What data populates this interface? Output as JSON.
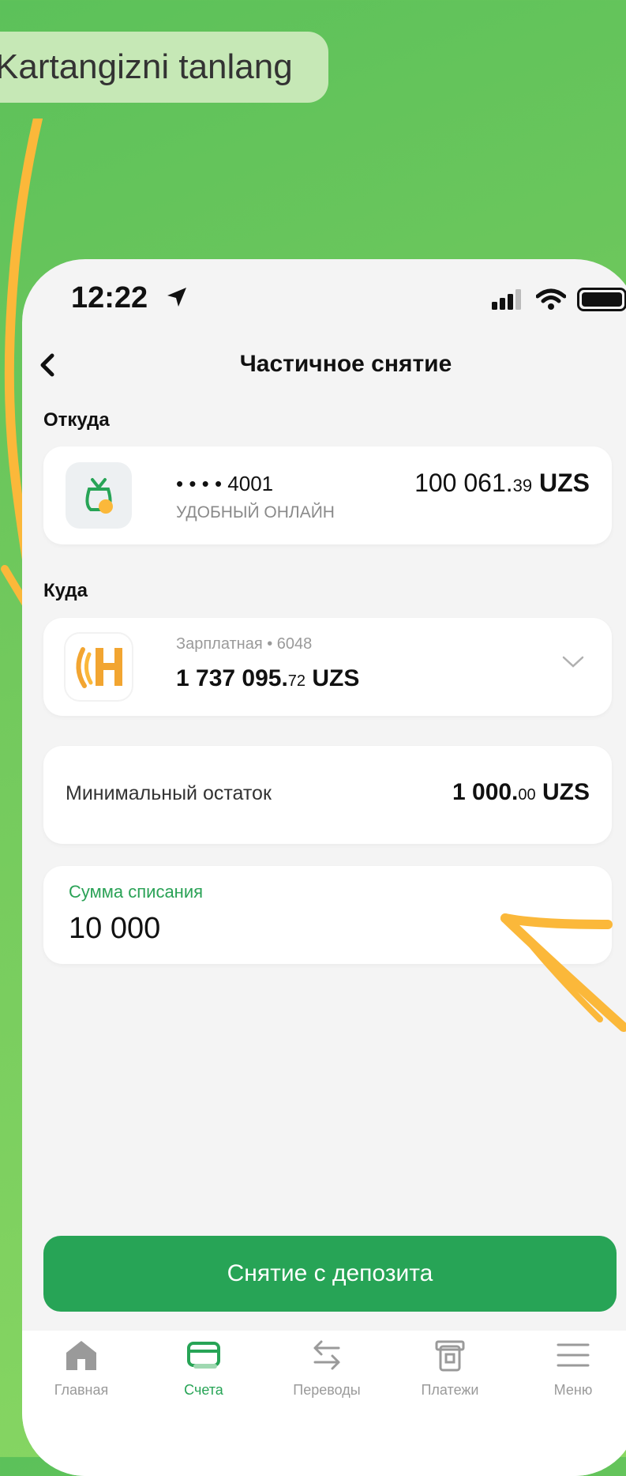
{
  "hint_text": "Kartangizni tanlang",
  "status": {
    "time": "12:22"
  },
  "header": {
    "title": "Частичное снятие"
  },
  "from": {
    "label": "Откуда",
    "card_number": "• • • • 4001",
    "card_name": "УДОБНЫЙ ОНЛАЙН",
    "amount_int": "100 061.",
    "amount_dec": "39",
    "currency": "UZS"
  },
  "to": {
    "label": "Куда",
    "card_name": "Зарплатная  • 6048",
    "amount_int": "1 737 095.",
    "amount_dec": "72",
    "currency": "UZS"
  },
  "min_balance": {
    "label": "Минимальный остаток",
    "amount_int": "1 000.",
    "amount_dec": "00",
    "currency": "UZS"
  },
  "amount_field": {
    "label": "Сумма списания",
    "value": "10 000"
  },
  "submit_label": "Снятие с депозита",
  "tabs": [
    {
      "label": "Главная"
    },
    {
      "label": "Счета"
    },
    {
      "label": "Переводы"
    },
    {
      "label": "Платежи"
    },
    {
      "label": "Меню"
    }
  ],
  "colors": {
    "accent": "#27a456",
    "arrow": "#fbb83a",
    "background": "#6fc85d"
  }
}
